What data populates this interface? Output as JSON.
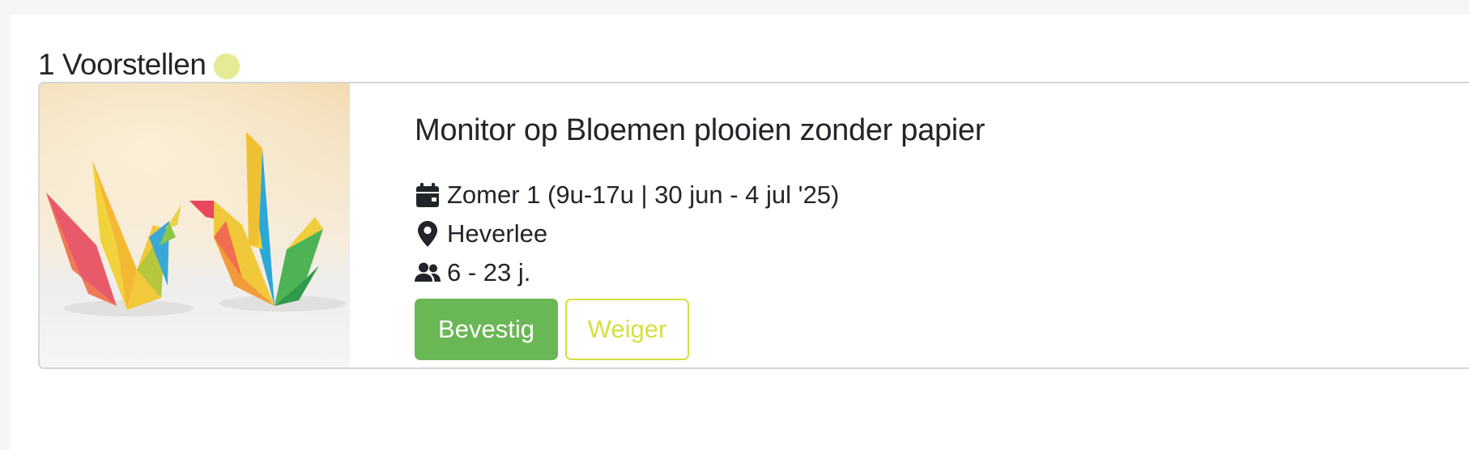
{
  "section": {
    "title": "1 Voorstellen",
    "status_color": "#e5ea94"
  },
  "card": {
    "image_icon": "origami-cranes-image",
    "title": "Monitor op Bloemen plooien zonder papier",
    "date_icon": "calendar-icon",
    "date": "Zomer 1 (9u-17u | 30 jun - 4 jul '25)",
    "location_icon": "map-pin-icon",
    "location": "Heverlee",
    "age_icon": "users-icon",
    "age": "6 - 23 j.",
    "confirm_label": "Bevestig",
    "decline_label": "Weiger"
  },
  "colors": {
    "confirm": "#6ab755",
    "decline": "#d7df3f",
    "border": "#d6d6d6"
  }
}
